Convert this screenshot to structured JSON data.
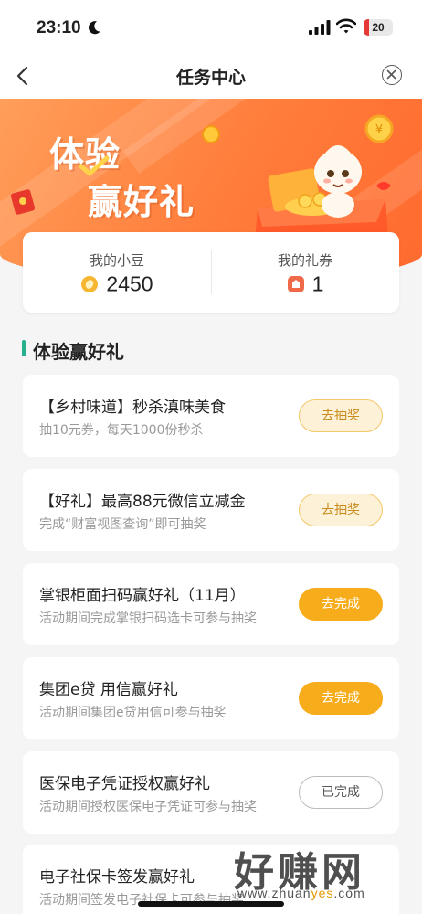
{
  "status_bar": {
    "time": "23:10",
    "battery_level": 20,
    "battery_text": "20"
  },
  "nav": {
    "title": "任务中心"
  },
  "banner": {
    "line1": "体验",
    "line2": "赢好礼"
  },
  "stats": {
    "beans_label": "我的小豆",
    "beans_value": "2450",
    "coupons_label": "我的礼券",
    "coupons_value": "1"
  },
  "section": {
    "title": "体验赢好礼"
  },
  "tasks": [
    {
      "title": "【乡村味道】秒杀滇味美食",
      "subtitle": "抽10元券，每天1000份秒杀",
      "button": "去抽奖",
      "state": "lottery"
    },
    {
      "title": "【好礼】最高88元微信立减金",
      "subtitle": "完成“财富视图查询”即可抽奖",
      "button": "去抽奖",
      "state": "lottery"
    },
    {
      "title": "掌银柜面扫码赢好礼（11月）",
      "subtitle": "活动期间完成掌银扫码选卡可参与抽奖",
      "button": "去完成",
      "state": "go"
    },
    {
      "title": "集团e贷 用信赢好礼",
      "subtitle": "活动期间集团e贷用信可参与抽奖",
      "button": "去完成",
      "state": "go"
    },
    {
      "title": "医保电子凭证授权赢好礼",
      "subtitle": "活动期间授权医保电子凭证可参与抽奖",
      "button": "已完成",
      "state": "done"
    },
    {
      "title": "电子社保卡签发赢好礼",
      "subtitle": "活动期间签发电子社保卡可参与抽奖",
      "button": "",
      "state": "hidden"
    }
  ],
  "watermark": {
    "main": "好赚网",
    "sub_prefix": "www.zhuan",
    "sub_highlight": "yes",
    "sub_suffix": ".com"
  },
  "colors": {
    "accent_orange": "#ff7c3a",
    "button_yellow": "#f7ac1b",
    "section_bar": "#27b08c"
  },
  "icons": [
    "back-arrow-icon",
    "close-circle-icon",
    "bean-coin-icon",
    "coupon-icon",
    "mascot-illustration"
  ]
}
